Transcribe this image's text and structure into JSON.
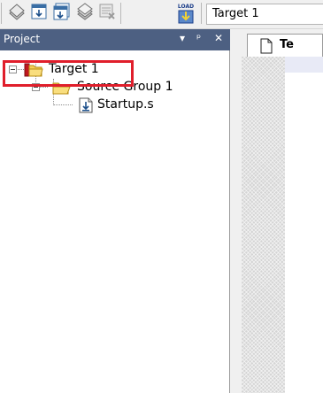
{
  "toolbar": {
    "icons": [
      "translate-icon",
      "build-icon",
      "rebuild-icon",
      "batch-build-icon",
      "stop-build-icon",
      "load-icon"
    ],
    "load_icon_text": "LOAD",
    "target_select_value": "Target 1"
  },
  "project_panel": {
    "title": "Project",
    "buttons": {
      "dropdown": "▾",
      "pin": "ᵖ",
      "close": "✕"
    },
    "tree": {
      "target": {
        "label": "Target 1",
        "expanded": true,
        "highlighted": true,
        "highlight_color": "#e01e2b"
      },
      "group": {
        "label": "Source Group 1",
        "expanded": true
      },
      "file": {
        "label": "Startup.s"
      }
    }
  },
  "editor": {
    "tab_label": "Te"
  },
  "colors": {
    "panel_header_bg": "#4d6082",
    "highlight": "#e01e2b"
  }
}
